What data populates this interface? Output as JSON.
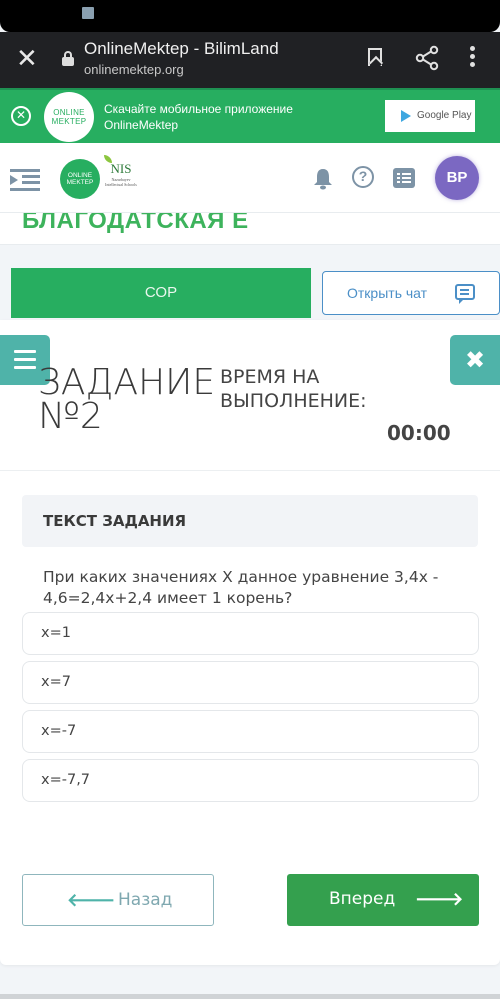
{
  "browser": {
    "title": "OnlineMektep - BilimLand",
    "url": "onlinemektep.org"
  },
  "app_banner": {
    "logo_line1": "ONLINE",
    "logo_line2": "MEKTEP",
    "text_line1": "Скачайте мобильное приложение",
    "text_line2": "OnlineMektep",
    "store_button": "Google Play"
  },
  "header": {
    "logo_line1": "ONLINE",
    "logo_line2": "MEKTEP",
    "partner_logo": "NIS",
    "partner_sub": "Nazarbayev Intellectual Schools",
    "avatar_initials": "BP"
  },
  "course": {
    "title": "БЛАГОДАТСКАЯ Е"
  },
  "actions": {
    "sor_label": "СОР",
    "chat_label": "Открыть чат"
  },
  "task": {
    "title": "ЗАДАНИЕ №2",
    "time_label": "ВРЕМЯ НА ВЫПОЛНЕНИЕ:",
    "time_value": "00:00",
    "section_label": "ТЕКСТ ЗАДАНИЯ",
    "question": "При каких значениях X данное уравнение 3,4x - 4,6=2,4x+2,4 имеет 1 корень?",
    "answers": [
      "x=1",
      "x=7",
      "x=-7",
      "x=-7,7"
    ]
  },
  "navigation": {
    "back_label": "Назад",
    "next_label": "Вперед"
  },
  "colors": {
    "brand_green": "#27ae60",
    "teal": "#4fb3a9",
    "avatar_purple": "#7b68c2",
    "chat_blue": "#4b8fc7"
  }
}
